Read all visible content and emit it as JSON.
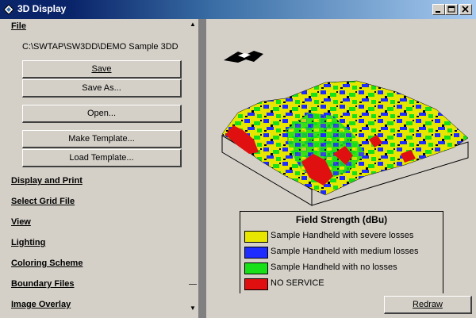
{
  "window": {
    "title": "3D Display"
  },
  "file": {
    "heading": "File",
    "path": "C:\\SWTAP\\SW3DD\\DEMO Sample 3DD",
    "save_label": "Save",
    "save_as_label": "Save As...",
    "open_label": "Open...",
    "make_template_label": "Make Template...",
    "load_template_label": "Load Template..."
  },
  "sections": [
    "Display and Print",
    "Select Grid File",
    "View",
    "Lighting",
    "Coloring Scheme",
    "Boundary Files",
    "Image Overlay"
  ],
  "legend": {
    "title": "Field Strength (dBu)",
    "items": [
      {
        "label": "Sample Handheld with severe losses",
        "color": "#e6e600"
      },
      {
        "label": "Sample Handheld with medium losses",
        "color": "#1e2cff"
      },
      {
        "label": "Sample Handheld with no losses",
        "color": "#18e018"
      },
      {
        "label": "NO SERVICE",
        "color": "#e01010"
      }
    ]
  },
  "redraw_label": "Redraw"
}
